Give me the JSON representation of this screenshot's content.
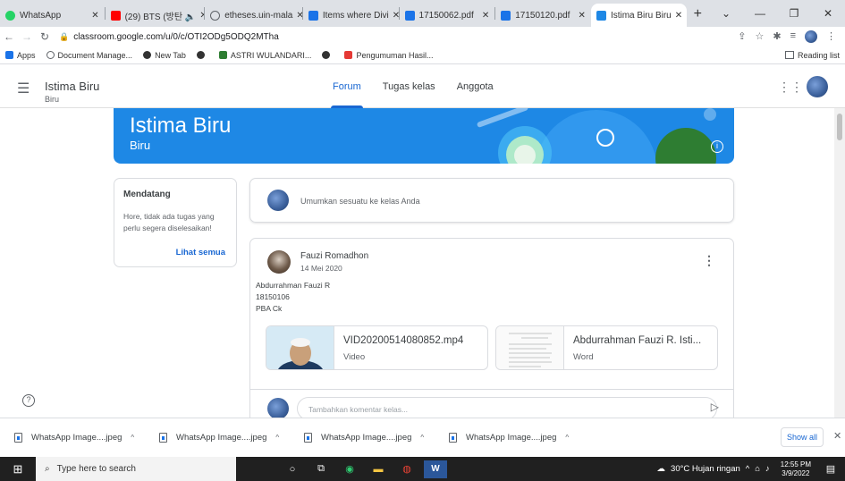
{
  "browser": {
    "tabs": [
      {
        "label": "WhatsApp",
        "color": "#25d366"
      },
      {
        "label": "(29) BTS (방탄 🔈",
        "color": "#ff0000"
      },
      {
        "label": "etheses.uin-mala",
        "color": "#5f6368"
      },
      {
        "label": "Items where Divi",
        "color": "#1a73e8"
      },
      {
        "label": "17150062.pdf",
        "color": "#1a73e8"
      },
      {
        "label": "17150120.pdf",
        "color": "#1a73e8"
      },
      {
        "label": "Istima Biru Biru",
        "color": "#1e88e5"
      }
    ],
    "new_tab": "+",
    "url": "classroom.google.com/u/0/c/OTI2ODg5ODQ2MTha",
    "bookmarks": [
      {
        "label": "Apps",
        "color": "#1a73e8"
      },
      {
        "label": "Document Manage...",
        "color": "#5f6368"
      },
      {
        "label": "New Tab",
        "color": "#333333"
      },
      {
        "label": "",
        "color": "#333333"
      },
      {
        "label": "ASTRI WULANDARI...",
        "color": "#2e7d32"
      },
      {
        "label": "",
        "color": "#333333"
      },
      {
        "label": "Pengumuman Hasil...",
        "color": "#e53935"
      }
    ],
    "reading_list": "Reading list"
  },
  "classroom": {
    "title": "Istima Biru",
    "subtitle": "Biru",
    "tabs": [
      {
        "label": "Forum",
        "active": true
      },
      {
        "label": "Tugas kelas",
        "active": false
      },
      {
        "label": "Anggota",
        "active": false
      }
    ],
    "banner": {
      "title": "Istima Biru",
      "subtitle": "Biru",
      "color": "#1e88e5"
    },
    "upcoming": {
      "heading": "Mendatang",
      "text": "Hore, tidak ada tugas yang perlu segera diselesaikan!",
      "link": "Lihat semua"
    },
    "announce_placeholder": "Umumkan sesuatu ke kelas Anda",
    "post": {
      "author": "Fauzi Romadhon",
      "date": "14 Mei 2020",
      "lines": [
        "Abdurrahman Fauzi R",
        "18150106",
        "PBA Ck"
      ],
      "attachments": [
        {
          "name": "VID20200514080852.mp4",
          "type": "Video"
        },
        {
          "name": "Abdurrahman Fauzi R. Isti...",
          "type": "Word"
        }
      ],
      "comment_placeholder": "Tambahkan komentar kelas..."
    }
  },
  "downloads": {
    "items": [
      "WhatsApp Image....jpeg",
      "WhatsApp Image....jpeg",
      "WhatsApp Image....jpeg",
      "WhatsApp Image....jpeg"
    ],
    "show_all": "Show all"
  },
  "taskbar": {
    "search_placeholder": "Type here to search",
    "weather": "30°C  Hujan ringan",
    "time": "12:55 PM",
    "date": "3/9/2022"
  }
}
